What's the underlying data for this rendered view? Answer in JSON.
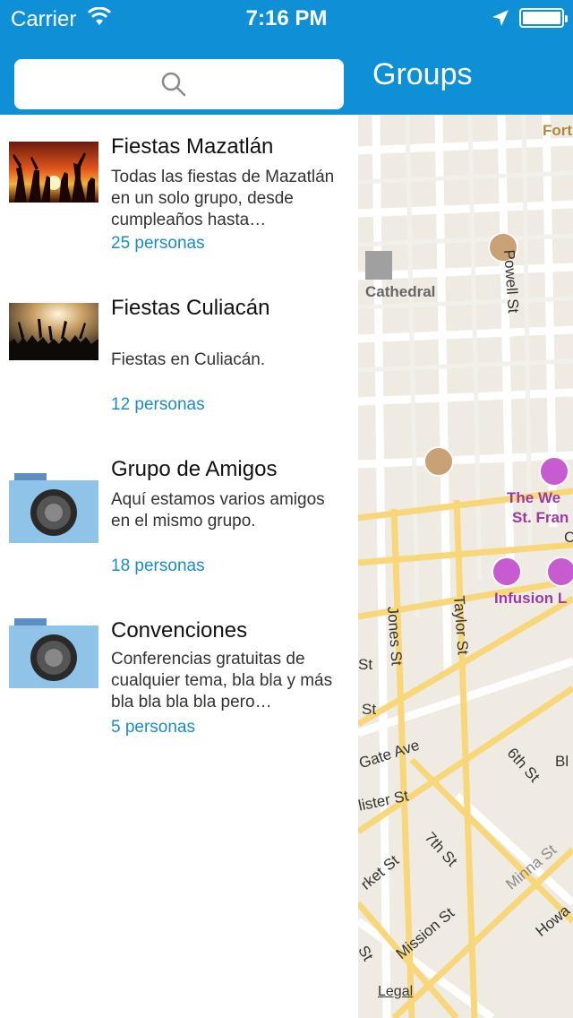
{
  "status_bar": {
    "carrier": "Carrier",
    "time": "7:16 PM"
  },
  "nav": {
    "title": "Groups",
    "search_icon": "search-icon"
  },
  "groups": [
    {
      "title": "Fiestas Mazatlán",
      "description": "Todas las fiestas de Mazatlán en un solo grupo, desde cumpleaños hasta…",
      "count": "25 personas",
      "thumbnail": "party-sunset-photo"
    },
    {
      "title": "Fiestas Culiacán",
      "description": "Fiestas en Culiacán.",
      "count": "12 personas",
      "thumbnail": "concert-crowd-photo"
    },
    {
      "title": "Grupo de Amigos",
      "description": "Aquí estamos varios amigos en el mismo grupo.",
      "count": "18 personas",
      "thumbnail": "camera-placeholder-icon"
    },
    {
      "title": "Convenciones",
      "description": "Conferencias gratuitas de cualquier tema, bla bla y más bla bla bla bla pero…",
      "count": "5 personas",
      "thumbnail": "camera-placeholder-icon"
    }
  ],
  "map": {
    "labels": {
      "cathedral": "Cathedral",
      "powell": "Powell St",
      "jones": "Jones St",
      "taylor": "Taylor St",
      "gate": "Gate Ave",
      "lister": "lister St",
      "sixth": "6th St",
      "seventh": "7th St",
      "market": "rket St",
      "mission": "Mission St",
      "minna": "Minna St",
      "howard": "Howa",
      "st1": "St",
      "st2": "St",
      "st3": "St",
      "westin": "The We",
      "stfran": "St. Fran",
      "infusion": "Infusion L",
      "fort": "Fort",
      "bl": "Bl",
      "c": "C"
    },
    "legal": "Legal"
  },
  "colors": {
    "brand": "#0f8fd6",
    "link": "#1a8bc9",
    "camera_body": "#8fc3e8"
  }
}
